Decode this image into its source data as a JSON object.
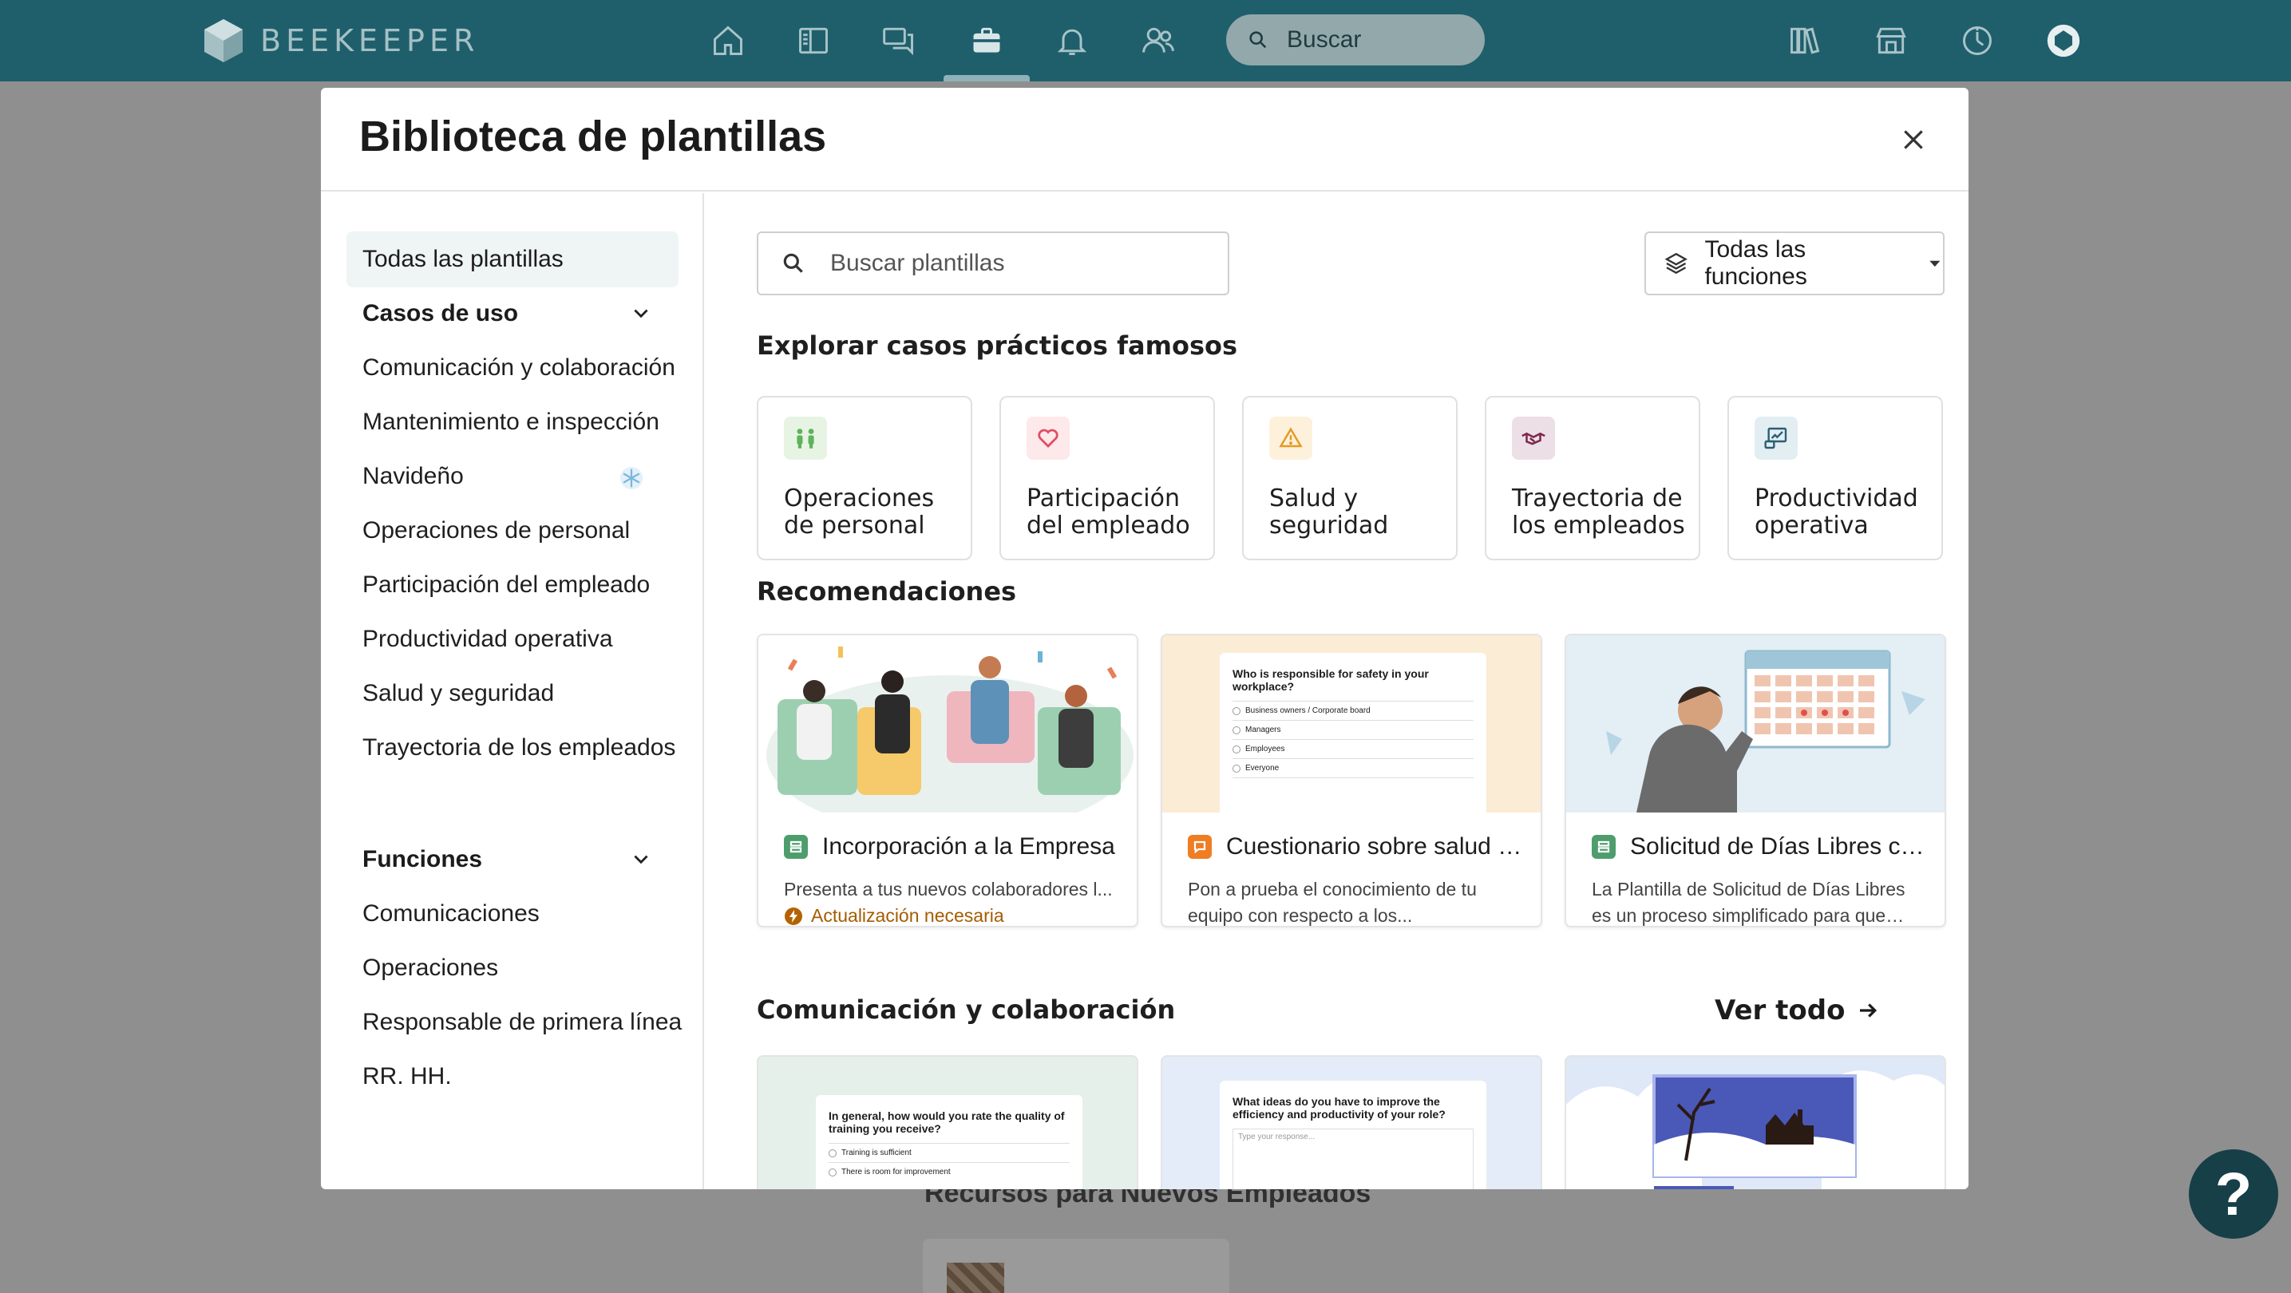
{
  "app": {
    "name": "BEEKEEPER"
  },
  "top_search": {
    "placeholder": "Buscar"
  },
  "colors": {
    "topbar": "#1f5f6c",
    "accent": "#1f5f6c",
    "warning": "#a35d00"
  },
  "modal": {
    "title": "Biblioteca de plantillas",
    "close_icon": "close-icon"
  },
  "sidebar": {
    "all_label": "Todas las plantillas",
    "use_cases_title": "Casos de uso",
    "use_cases": [
      "Comunicación y colaboración",
      "Mantenimiento e inspección",
      "Navideño",
      "Operaciones de personal",
      "Participación del empleado",
      "Productividad operativa",
      "Salud y seguridad",
      "Trayectoria de los empleados"
    ],
    "functions_title": "Funciones",
    "functions": [
      "Comunicaciones",
      "Operaciones",
      "Responsable de primera línea",
      "RR. HH."
    ]
  },
  "main": {
    "search_placeholder": "Buscar plantillas",
    "function_filter": "Todas las funciones",
    "explore_title": "Explorar casos prácticos famosos",
    "categories": [
      {
        "label": "Operaciones de personal",
        "icon": "people-icon",
        "color": "#e7f4e4"
      },
      {
        "label": "Participación del empleado",
        "icon": "heart-icon",
        "color": "#fde8ea"
      },
      {
        "label": "Salud y seguridad",
        "icon": "warning-icon",
        "color": "#fdf1dc"
      },
      {
        "label": "Trayectoria de los empleados",
        "icon": "handshake-icon",
        "color": "#ecdfe6"
      },
      {
        "label": "Productividad operativa",
        "icon": "productivity-icon",
        "color": "#e3eef3"
      }
    ],
    "recommendations_title": "Recomendaciones",
    "recommendations": [
      {
        "title": "Incorporación a la Empresa",
        "description": "Presenta a tus nuevos colaboradores l...",
        "badge": "Actualización necesaria",
        "image_bg": "#e9f1ee"
      },
      {
        "title": "Cuestionario sobre salud y...",
        "description": "Pon a prueba el conocimiento de tu equipo con respecto a los...",
        "image_bg": "#fbecd5",
        "preview": {
          "question": "Who is responsible for safety in your workplace?",
          "options": [
            "Business owners / Corporate board",
            "Managers",
            "Employees",
            "Everyone"
          ]
        }
      },
      {
        "title": "Solicitud de Días Libres co...",
        "description": "La Plantilla de Solicitud de Días Libres es un proceso simplificado para que los...",
        "image_bg": "#e3eff5"
      }
    ],
    "communication_title": "Comunicación y colaboración",
    "see_all": "Ver todo",
    "communication_previews": [
      {
        "question": "In general, how would you rate the quality of training you receive?",
        "options": [
          "Training is sufficient",
          "There is room for improvement"
        ],
        "image_bg": "#e6f0ea"
      },
      {
        "question": "What ideas do you have to improve the efficiency and productivity of your role?",
        "input_placeholder": "Type your response...",
        "image_bg": "#e3ecf8"
      },
      {
        "image_bg": "#dfe8f7"
      }
    ]
  },
  "background": {
    "section_title": "Recursos para Nuevos Empleados"
  },
  "help": {
    "label": "?"
  }
}
